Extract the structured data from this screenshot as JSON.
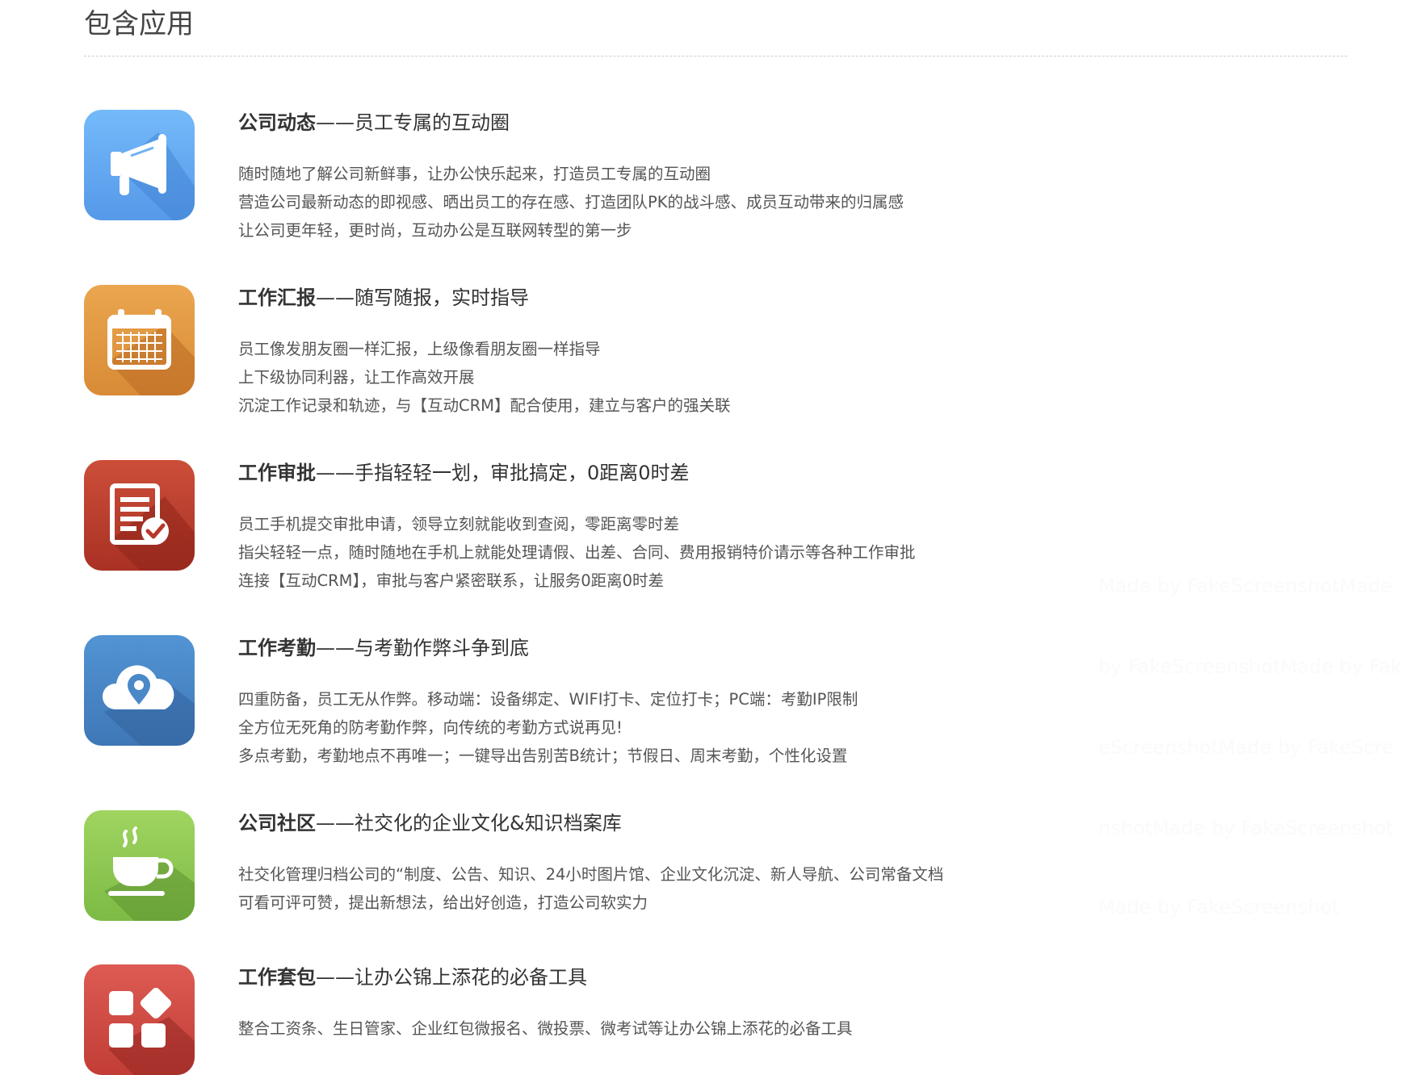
{
  "section": {
    "title": "包含应用"
  },
  "apps": [
    {
      "name": "公司动态",
      "sep": "——",
      "subtitle": "员工专属的互动圈",
      "icon": "megaphone-icon",
      "colors": [
        "#6fb6f6",
        "#4f8fe0"
      ],
      "lines": [
        "随时随地了解公司新鲜事，让办公快乐起来，打造员工专属的互动圈",
        "营造公司最新动态的即视感、晒出员工的存在感、打造团队PK的战斗感、成员互动带来的归属感",
        "让公司更年轻，更时尚，互动办公是互联网转型的第一步"
      ]
    },
    {
      "name": "工作汇报",
      "sep": "——",
      "subtitle": "随写随报，实时指导",
      "icon": "calendar-icon",
      "colors": [
        "#e9a44e",
        "#c97a2b"
      ],
      "lines": [
        "员工像发朋友圈一样汇报，上级像看朋友圈一样指导",
        "上下级协同利器，让工作高效开展",
        "沉淀工作记录和轨迹，与【互动CRM】配合使用，建立与客户的强关联"
      ]
    },
    {
      "name": "工作审批",
      "sep": "——",
      "subtitle": "手指轻轻一划，审批搞定，0距离0时差",
      "icon": "approval-document-icon",
      "colors": [
        "#c84a36",
        "#9f2d22"
      ],
      "lines": [
        "员工手机提交审批申请，领导立刻就能收到查阅，零距离零时差",
        "指尖轻轻一点，随时随地在手机上就能处理请假、出差、合同、费用报销特价请示等各种工作审批",
        "连接【互动CRM】，审批与客户紧密联系，让服务0距离0时差"
      ]
    },
    {
      "name": "工作考勤",
      "sep": "——",
      "subtitle": "与考勤作弊斗争到底",
      "icon": "cloud-location-icon",
      "colors": [
        "#4f8fd0",
        "#3b6fae"
      ],
      "lines": [
        "四重防备，员工无从作弊。移动端：设备绑定、WIFI打卡、定位打卡；PC端：考勤IP限制",
        "全方位无死角的防考勤作弊，向传统的考勤方式说再见!",
        "多点考勤，考勤地点不再唯一；一键导出告别苦B统计；节假日、周末考勤，个性化设置"
      ]
    },
    {
      "name": "公司社区",
      "sep": "——",
      "subtitle": "社交化的企业文化&知识档案库",
      "icon": "coffee-cup-icon",
      "colors": [
        "#9ad15a",
        "#6ba83a"
      ],
      "lines": [
        "社交化管理归档公司的“制度、公告、知识、24小时图片馆、企业文化沉淀、新人导航、公司常备文档",
        "可看可评可赞，提出新想法，给出好创造，打造公司软实力"
      ]
    },
    {
      "name": "工作套包",
      "sep": "——",
      "subtitle": "让办公锦上添花的必备工具",
      "icon": "apps-grid-icon",
      "colors": [
        "#dc5a52",
        "#b8342f"
      ],
      "lines": [
        "整合工资条、生日管家、企业红包微报名、微投票、微考试等让办公锦上添花的必备工具"
      ]
    }
  ],
  "watermark": [
    "Made by FakeScreenshotMade",
    "by FakeScreenshotMade by Fak",
    "eScreenshotMade by FakeScre",
    "nshotMade by FakeScreenshot",
    "Made by FakeScreenshot"
  ]
}
